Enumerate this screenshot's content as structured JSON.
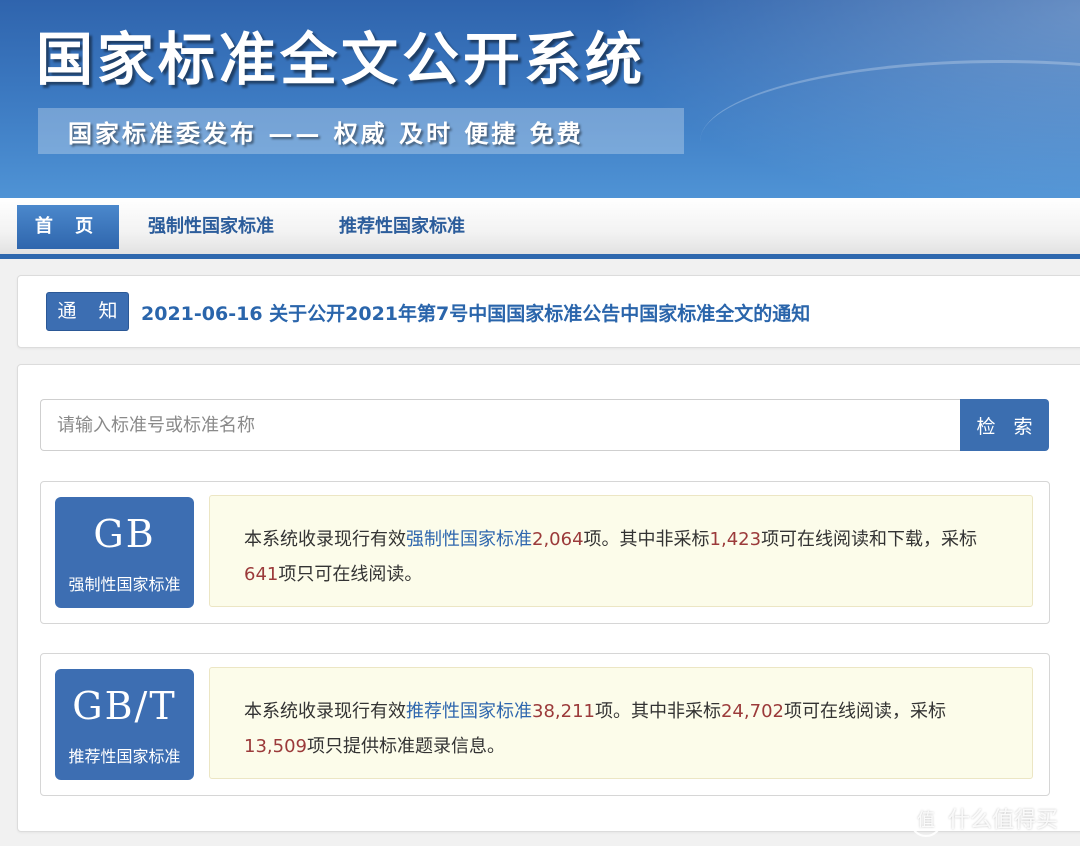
{
  "banner": {
    "title": "国家标准全文公开系统",
    "slogan": "国家标准委发布 —— 权威 及时 便捷 免费"
  },
  "nav": {
    "items": [
      {
        "label": "首 页",
        "active": true
      },
      {
        "label": "强制性国家标准",
        "active": false
      },
      {
        "label": "推荐性国家标准",
        "active": false
      }
    ]
  },
  "notice": {
    "badge": "通 知",
    "text": "2021-06-16  关于公开2021年第7号中国国家标准公告中国家标准全文的通知"
  },
  "search": {
    "placeholder": "请输入标准号或标准名称",
    "value": "",
    "button_label": "检 索"
  },
  "standards": [
    {
      "code": "GB",
      "label": "强制性国家标准",
      "text_prefix": "本系统收录现行有效",
      "link": "强制性国家标准",
      "total": "2,064",
      "text_mid1": "项。其中非采标",
      "non_adopted": "1,423",
      "text_mid2": "项可在线阅读和下载，采标",
      "adopted": "641",
      "text_suffix": "项只可在线阅读。"
    },
    {
      "code": "GB/T",
      "label": "推荐性国家标准",
      "text_prefix": "本系统收录现行有效",
      "link": "推荐性国家标准",
      "total": "38,211",
      "text_mid1": "项。其中非采标",
      "non_adopted": "24,702",
      "text_mid2": "项可在线阅读，采标",
      "adopted": "13,509",
      "text_suffix": "项只提供标准题录信息。"
    }
  ],
  "watermark": {
    "icon": "值",
    "text": "什么值得买"
  },
  "colors": {
    "primary": "#3b6eb0",
    "link": "#2f67ae",
    "number": "#9b3a3a",
    "info_bg": "#fcfcea"
  }
}
